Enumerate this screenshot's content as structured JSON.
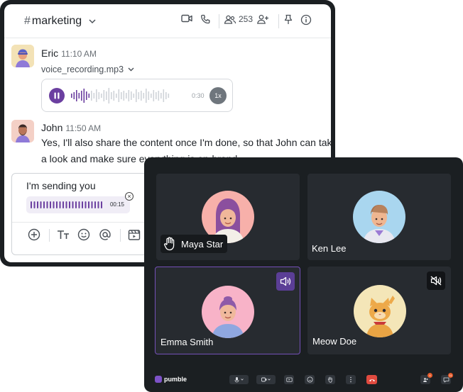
{
  "chat": {
    "channel": "marketing",
    "member_count": "253",
    "icons": [
      "hash",
      "chevron-down",
      "video-camera",
      "phone",
      "members",
      "add-member",
      "pin",
      "info"
    ]
  },
  "messages": [
    {
      "author": "Eric",
      "time": "11:10 AM",
      "attachment": {
        "filename": "voice_recording.mp3",
        "duration": "0:30",
        "speed": "1x"
      }
    },
    {
      "author": "John",
      "time": "11:50 AM",
      "text": "Yes, I'll also share the content once I'm done, so that John can take a look and make sure everything is on-brand."
    }
  ],
  "composer": {
    "text": "I'm sending you",
    "recording_time": "00:15",
    "tools": [
      "plus",
      "text-format",
      "emoji",
      "mention",
      "media"
    ]
  },
  "meeting": {
    "participants": [
      {
        "name": "Maya Star",
        "hand_raised": true
      },
      {
        "name": "Ken Lee"
      },
      {
        "name": "Emma Smith",
        "speaking": true
      },
      {
        "name": "Meow Doe",
        "muted": true
      }
    ],
    "logo_text": "pumble",
    "participants_badge": "4",
    "chat_badge": "11",
    "colors": {
      "accent": "#7450b8",
      "end_call": "#e04a3f",
      "background": "#1b1f22",
      "tile": "#272b30"
    }
  }
}
